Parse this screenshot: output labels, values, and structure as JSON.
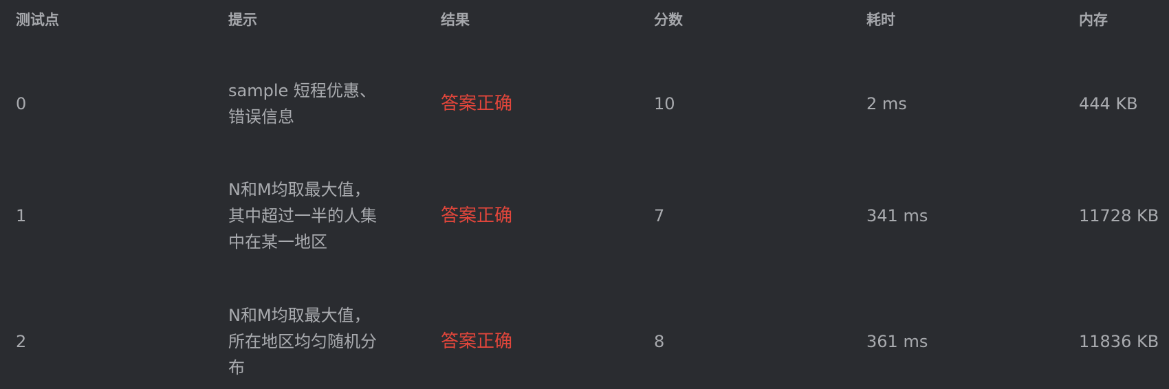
{
  "headers": [
    "测试点",
    "提示",
    "结果",
    "分数",
    "耗时",
    "内存"
  ],
  "rows": [
    {
      "id": "0",
      "hint_lines": [
        "sample 短程优惠、",
        "错误信息"
      ],
      "result": "答案正确",
      "score": "10",
      "time": "2 ms",
      "memory": "444 KB"
    },
    {
      "id": "1",
      "hint_lines": [
        "N和M均取最大值，",
        "其中超过一半的人集",
        "中在某一地区"
      ],
      "result": "答案正确",
      "score": "7",
      "time": "341 ms",
      "memory": "11728 KB"
    },
    {
      "id": "2",
      "hint_lines": [
        "N和M均取最大值，",
        "所在地区均匀随机分",
        "布"
      ],
      "result": "答案正确",
      "score": "8",
      "time": "361 ms",
      "memory": "11836 KB"
    }
  ],
  "colors": {
    "background": "#2a2c30",
    "text": "#a9abaf",
    "header_text": "#a6a8ac",
    "accepted": "#e2463b"
  }
}
